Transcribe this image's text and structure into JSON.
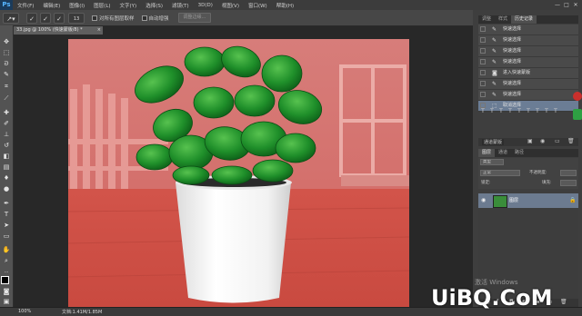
{
  "app": {
    "logo": "Ps"
  },
  "menubar": {
    "items": [
      "文件(F)",
      "编辑(E)",
      "图像(I)",
      "图层(L)",
      "文字(Y)",
      "选择(S)",
      "滤镜(T)",
      "3D(D)",
      "视图(V)",
      "窗口(W)",
      "帮助(H)"
    ],
    "window_controls": [
      "—",
      "□",
      "✕"
    ]
  },
  "options_bar": {
    "brush_size": "13",
    "sample_all_layers": "对所有图层取样",
    "auto_enhance": "自动增强",
    "refine_edge": "调整边缘..."
  },
  "document": {
    "tab_title": "33.jpg @ 100% (快速蒙版/8) *",
    "tab_close": "×"
  },
  "status_bar": {
    "zoom": "100%",
    "doc_info": "文档:1.41M/1.85M"
  },
  "panels": {
    "history_tabs": [
      "调整",
      "样式",
      "历史记录"
    ],
    "history_items": [
      {
        "label": "快速选择",
        "selected": false
      },
      {
        "label": "快速选择",
        "selected": false
      },
      {
        "label": "快速选择",
        "selected": false
      },
      {
        "label": "快速选择",
        "selected": false
      },
      {
        "label": "进入快速蒙版",
        "selected": false
      },
      {
        "label": "快速选择",
        "selected": false
      },
      {
        "label": "快速选择",
        "selected": false
      },
      {
        "label": "取消选择",
        "selected": true
      }
    ],
    "history_footer_label": "通道蒙版",
    "layers_tabs": [
      "图层",
      "通道",
      "路径"
    ],
    "kind_select": "类型",
    "blend_mode": "正常",
    "opacity_label": "不透明度:",
    "lock_label": "锁定:",
    "fill_label": "填充:",
    "layer_name": "图层"
  },
  "watermark": {
    "activate_windows": "激活 Windows",
    "site_logo": "UiBQ.CoM"
  },
  "colors": {
    "menubar": "#3c3c3c",
    "panel": "#3e3e3e",
    "selection": "#6b7d95",
    "quickmask": "#d46a6a"
  }
}
